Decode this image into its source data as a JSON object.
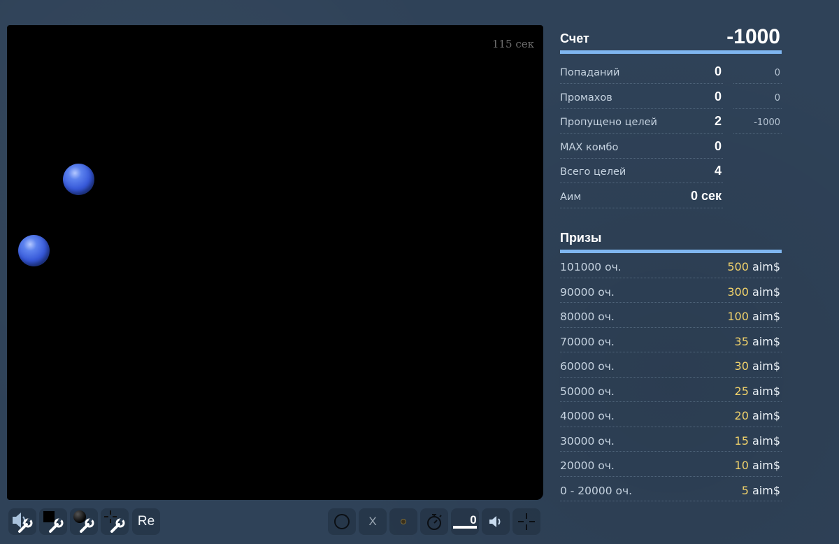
{
  "game": {
    "timer": "115 сек",
    "balls": [
      {
        "id": "ball-1"
      },
      {
        "id": "ball-2"
      }
    ]
  },
  "toolbar": {
    "restart_label": "Re",
    "miss_label": "X",
    "speed_value": "0",
    "icons": [
      "sound-settings-icon",
      "background-settings-icon",
      "target-settings-icon",
      "crosshair-settings-icon",
      "circle-target-icon",
      "miss-icon",
      "dot-icon",
      "stopwatch-icon",
      "speaker-icon",
      "crosshair-icon"
    ]
  },
  "score": {
    "title": "Счет",
    "value": "-1000"
  },
  "stats": [
    {
      "label": "Попаданий",
      "value": "0",
      "points": "0"
    },
    {
      "label": "Промахов",
      "value": "0",
      "points": "0"
    },
    {
      "label": "Пропущено целей",
      "value": "2",
      "points": "-1000"
    },
    {
      "label": "MAX комбо",
      "value": "0",
      "points": ""
    },
    {
      "label": "Всего целей",
      "value": "4",
      "points": ""
    },
    {
      "label": "Аим",
      "value": "0 сек",
      "points": ""
    }
  ],
  "prizes": {
    "title": "Призы",
    "unit": "aim$",
    "items": [
      {
        "label": "101000 оч.",
        "amount": "500"
      },
      {
        "label": "90000 оч.",
        "amount": "300"
      },
      {
        "label": "80000 оч.",
        "amount": "100"
      },
      {
        "label": "70000 оч.",
        "amount": "35"
      },
      {
        "label": "60000 оч.",
        "amount": "30"
      },
      {
        "label": "50000 оч.",
        "amount": "25"
      },
      {
        "label": "40000 оч.",
        "amount": "20"
      },
      {
        "label": "30000 оч.",
        "amount": "15"
      },
      {
        "label": "20000 оч.",
        "amount": "10"
      },
      {
        "label": "0 - 20000 оч.",
        "amount": "5"
      }
    ]
  },
  "colors": {
    "accent": "#7fb6f0",
    "prize_amount": "#f2d36b",
    "ball": "#3658d8"
  }
}
